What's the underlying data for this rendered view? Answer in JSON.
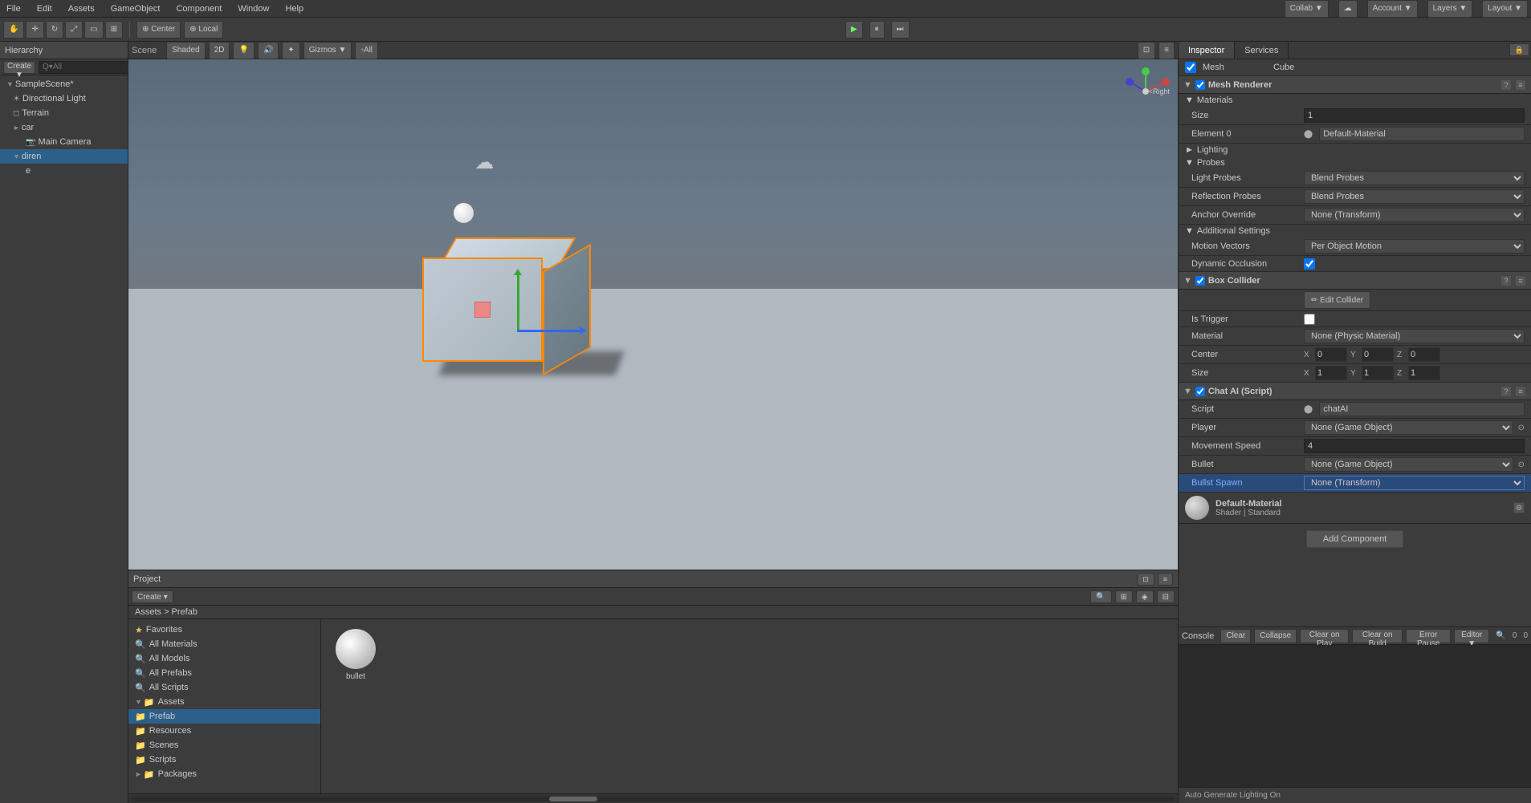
{
  "menubar": {
    "items": [
      "File",
      "Edit",
      "Assets",
      "GameObject",
      "Component",
      "Window",
      "Help"
    ]
  },
  "topright": {
    "collab_label": "Collab ▼",
    "cloud_label": "☁",
    "account_label": "Account ▼",
    "layers_label": "Layers ▼",
    "layout_label": "Layout ▼"
  },
  "toolbar": {
    "center_label": "⊕ Center",
    "local_label": "⊕ Local",
    "play_label": "▶",
    "pause_label": "⏸",
    "step_label": "⏭"
  },
  "hierarchy": {
    "title": "Hierarchy",
    "create_label": "Create ▼",
    "search_placeholder": "Q▾All",
    "items": [
      {
        "label": "SampleScene*",
        "indent": 0,
        "arrow": "▼"
      },
      {
        "label": "Directional Light",
        "indent": 1,
        "arrow": "",
        "icon": "☀"
      },
      {
        "label": "Terrain",
        "indent": 1,
        "arrow": "",
        "icon": "◻"
      },
      {
        "label": "car",
        "indent": 1,
        "arrow": "►",
        "icon": ""
      },
      {
        "label": "Main Camera",
        "indent": 2,
        "arrow": "",
        "icon": "📷"
      },
      {
        "label": "diren",
        "indent": 1,
        "arrow": "▼",
        "icon": ""
      },
      {
        "label": "e",
        "indent": 2,
        "arrow": "",
        "icon": ""
      }
    ]
  },
  "scene": {
    "title": "Scene",
    "view_mode": "Shaded",
    "projection": "2D",
    "gizmos_label": "Gizmos ▼",
    "all_label": "◦All",
    "right_label": "<Right"
  },
  "inspector": {
    "title": "Inspector",
    "services_label": "Services",
    "mesh_label": "Mesh",
    "mesh_value": "Cube",
    "components": {
      "mesh_renderer": {
        "title": "Mesh Renderer",
        "materials_label": "Materials",
        "size_label": "Size",
        "size_value": "1",
        "element0_label": "Element 0",
        "element0_value": "Default-Material",
        "lighting_label": "Lighting",
        "probes_label": "Probes",
        "light_probes_label": "Light Probes",
        "light_probes_value": "Blend Probes",
        "reflection_probes_label": "Reflection Probes",
        "reflection_probes_value": "Blend Probes",
        "anchor_override_label": "Anchor Override",
        "anchor_override_value": "None (Transform)",
        "additional_settings_label": "Additional Settings",
        "motion_vectors_label": "Motion Vectors",
        "motion_vectors_value": "Per Object Motion",
        "dynamic_occlusion_label": "Dynamic Occlusion",
        "dynamic_occlusion_checked": true
      },
      "box_collider": {
        "title": "Box Collider",
        "edit_collider_label": "Edit Collider",
        "is_trigger_label": "Is Trigger",
        "is_trigger_checked": false,
        "material_label": "Material",
        "material_value": "None (Physic Material)",
        "center_label": "Center",
        "center_x": "0",
        "center_y": "0",
        "center_z": "0",
        "size_label": "Size",
        "size_x": "1",
        "size_y": "1",
        "size_z": "1"
      },
      "chat_ai": {
        "title": "Chat AI (Script)",
        "script_label": "Script",
        "script_value": "chatAI",
        "player_label": "Player",
        "player_value": "None (Game Object)",
        "movement_speed_label": "Movement Speed",
        "movement_speed_value": "4",
        "bullet_label": "Bullet",
        "bullet_value": "None (Game Object)",
        "bullst_spawn_label": "Bullst Spawn",
        "bullst_spawn_value": "None (Transform)"
      }
    },
    "material_preview": {
      "name": "Default-Material",
      "shader": "Shader | Standard"
    },
    "add_component_label": "Add Component"
  },
  "project": {
    "title": "Project",
    "create_label": "Create ▾",
    "search_placeholder": "🔍",
    "breadcrumb": "Assets > Prefab",
    "favorites": {
      "label": "Favorites",
      "items": [
        "All Materials",
        "All Models",
        "All Prefabs",
        "All Scripts"
      ]
    },
    "assets": {
      "label": "Assets",
      "children": [
        {
          "label": "Prefab",
          "selected": true
        },
        {
          "label": "Resources"
        },
        {
          "label": "Scenes"
        },
        {
          "label": "Scripts"
        }
      ]
    },
    "packages_label": "Packages",
    "asset_files": [
      {
        "name": "bullet",
        "type": "sphere"
      }
    ]
  },
  "console": {
    "title": "Console",
    "clear_label": "Clear",
    "collapse_label": "Collapse",
    "clear_on_play_label": "Clear on Play",
    "clear_on_build_label": "Clear on Build",
    "error_pause_label": "Error Pause",
    "editor_label": "Editor ▼"
  },
  "status_bar": {
    "text": "Auto Generate Lighting On"
  }
}
